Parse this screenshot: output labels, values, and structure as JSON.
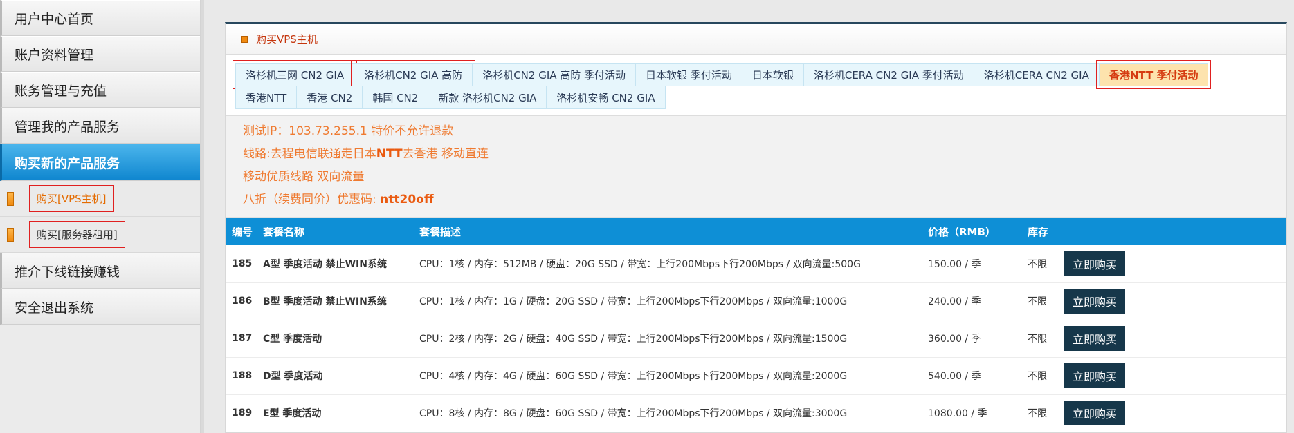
{
  "sidebar": {
    "items": [
      {
        "label": "用户中心首页"
      },
      {
        "label": "账户资料管理"
      },
      {
        "label": "账务管理与充值"
      },
      {
        "label": "管理我的产品服务"
      },
      {
        "label": "购买新的产品服务"
      }
    ],
    "sub_items": [
      {
        "label": "购买[VPS主机]"
      },
      {
        "label": "购买[服务器租用]"
      }
    ],
    "bottom_items": [
      {
        "label": "推介下线链接赚钱"
      },
      {
        "label": "安全退出系统"
      }
    ]
  },
  "panel": {
    "title": "购买VPS主机"
  },
  "tabs": [
    {
      "label": "洛杉机三网 CN2 GIA"
    },
    {
      "label": "洛杉机CN2 GIA 高防"
    },
    {
      "label": "洛杉机CN2 GIA 高防 季付活动"
    },
    {
      "label": "日本软银 季付活动"
    },
    {
      "label": "日本软银"
    },
    {
      "label": "洛杉机CERA CN2 GIA 季付活动"
    },
    {
      "label": "洛杉机CERA CN2 GIA"
    },
    {
      "label": "香港NTT 季付活动"
    },
    {
      "label": "香港NTT"
    },
    {
      "label": "香港 CN2"
    },
    {
      "label": "韩国 CN2"
    },
    {
      "label": "新款 洛杉机CN2 GIA"
    },
    {
      "label": "洛杉机安畅 CN2 GIA"
    }
  ],
  "notes": {
    "line1": "测试IP：103.73.255.1 特价不允许退款",
    "line2_prefix": "线路:去程电信联通走日本",
    "line2_bold": "NTT",
    "line2_suffix": "去香港 移动直连",
    "line3": "移动优质线路 双向流量",
    "line4_prefix": "八折（续费同价）优惠码: ",
    "line4_code": "ntt20off"
  },
  "table": {
    "headers": {
      "id": "编号",
      "name": "套餐名称",
      "desc": "套餐描述",
      "price": "价格（RMB）",
      "stock": "库存"
    },
    "rows": [
      {
        "id": "185",
        "name": "A型 季度活动 禁止WIN系统",
        "desc": "CPU：1核 / 内存：512MB / 硬盘：20G SSD / 带宽：上行200Mbps下行200Mbps / 双向流量:500G",
        "price": "150.00 / 季",
        "stock": "不限",
        "button": "立即购买"
      },
      {
        "id": "186",
        "name": "B型 季度活动 禁止WIN系统",
        "desc": "CPU：1核 / 内存：1G / 硬盘：20G SSD / 带宽：上行200Mbps下行200Mbps / 双向流量:1000G",
        "price": "240.00 / 季",
        "stock": "不限",
        "button": "立即购买"
      },
      {
        "id": "187",
        "name": "C型 季度活动",
        "desc": "CPU：2核 / 内存：2G / 硬盘：40G SSD / 带宽：上行200Mbps下行200Mbps / 双向流量:1500G",
        "price": "360.00 / 季",
        "stock": "不限",
        "button": "立即购买"
      },
      {
        "id": "188",
        "name": "D型 季度活动",
        "desc": "CPU：4核 / 内存：4G / 硬盘：60G SSD / 带宽：上行200Mbps下行200Mbps / 双向流量:2000G",
        "price": "540.00 / 季",
        "stock": "不限",
        "button": "立即购买"
      },
      {
        "id": "189",
        "name": "E型 季度活动",
        "desc": "CPU：8核 / 内存：8G / 硬盘：60G SSD / 带宽：上行200Mbps下行200Mbps / 双向流量:3000G",
        "price": "1080.00 / 季",
        "stock": "不限",
        "button": "立即购买"
      }
    ]
  },
  "colors": {
    "accent_blue": "#0e8fd6",
    "highlight_orange": "#ef7a30",
    "button_dark": "#16374a"
  }
}
